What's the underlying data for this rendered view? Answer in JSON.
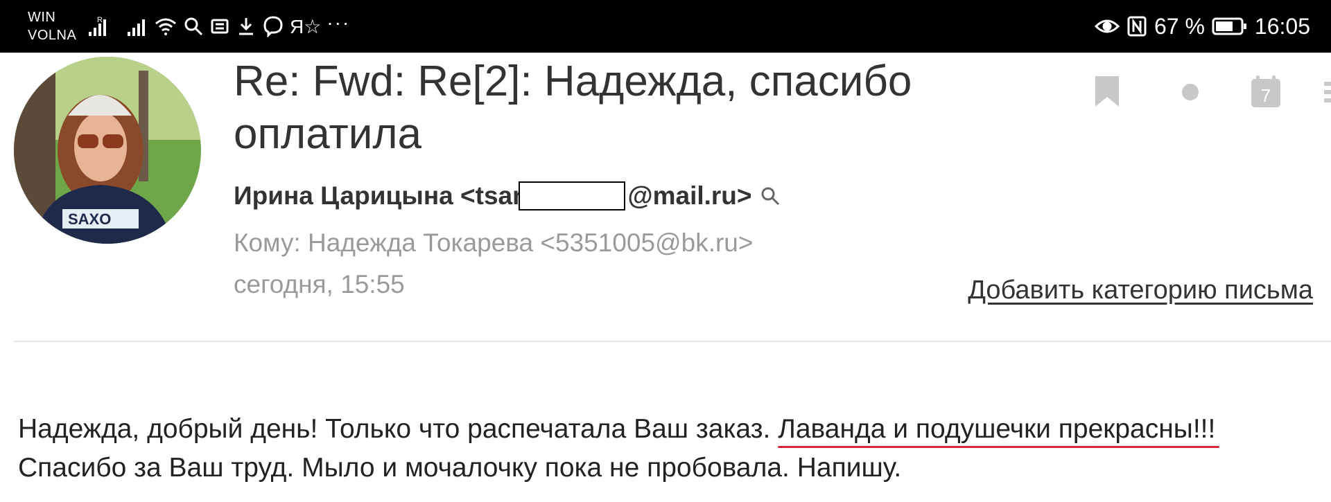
{
  "status_bar": {
    "carrier_line1": "WIN",
    "carrier_line2": "VOLNA",
    "roaming_badge": "R",
    "battery_percent": "67 %",
    "time": "16:05",
    "overflow": "···",
    "left_icons": [
      "signal-icon",
      "signal-icon",
      "wifi-icon",
      "search-icon",
      "news-icon",
      "download-icon",
      "viber-icon",
      "yandex-icon"
    ],
    "right_icons": [
      "eye-icon",
      "nfc-icon",
      "battery-icon"
    ]
  },
  "email": {
    "subject": "Re: Fwd: Re[2]: Надежда, спасибо оплатила",
    "sender_prefix": "Ирина Царицына <tsar",
    "sender_suffix": "@mail.ru>",
    "recipient": "Кому: Надежда Токарева <5351005@bk.ru>",
    "date": "сегодня, 15:55",
    "add_category": "Добавить категорию письма",
    "calendar_day": "7",
    "body_line1_plain": "Надежда, добрый день! Только что распечатала Ваш заказ. ",
    "body_line1_highlight": "Лаванда и подушечки прекрасны!!!",
    "body_line2": "Спасибо за Ваш труд. Мыло и мочалочку пока не пробовала. Напишу."
  },
  "toolbar_icons": [
    "bookmark-icon",
    "unread-dot-icon",
    "calendar-icon",
    "more-icon"
  ],
  "colors": {
    "status_bar_bg": "#000000",
    "subject": "#333333",
    "secondary_text": "#9a9a9a",
    "icon_gray": "#c8c8c8",
    "highlight_underline": "#d6283a"
  }
}
